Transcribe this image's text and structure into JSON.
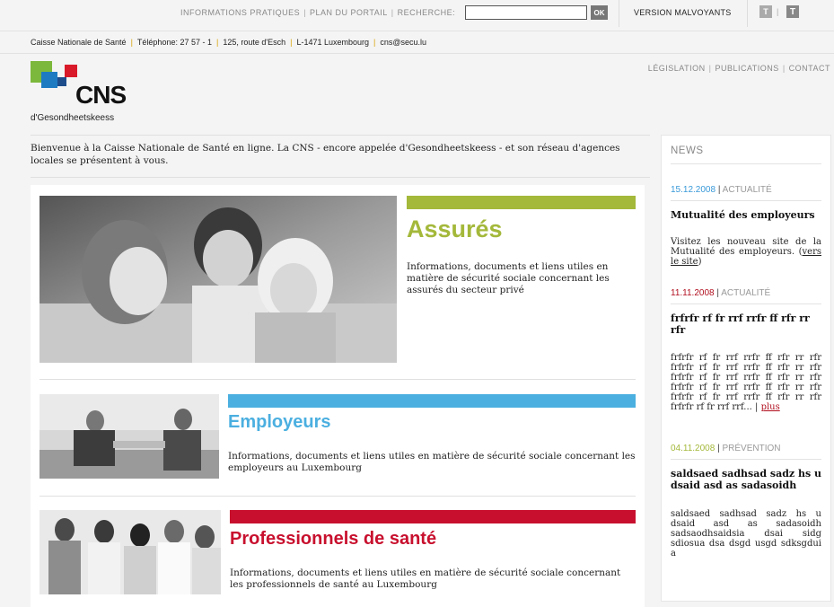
{
  "top_nav": {
    "info": "INFORMATIONS PRATIQUES",
    "plan": "PLAN DU PORTAIL",
    "recherche": "RECHERCHE:",
    "ok": "OK",
    "malvoyants": "VERSION MALVOYANTS",
    "t_small": "T",
    "t_large": "T"
  },
  "search": {
    "value": ""
  },
  "address": {
    "org": "Caisse Nationale de Santé",
    "phone": "Téléphone: 27 57 - 1",
    "street": "125, route d'Esch",
    "city": "L-1471 Luxembourg",
    "email": "cns@secu.lu"
  },
  "logo": {
    "text": "CNS",
    "sub": "d'Gesondheetskeess"
  },
  "right_links": {
    "legislation": "LÉGISLATION",
    "publications": "PUBLICATIONS",
    "contact": "CONTACT"
  },
  "intro": "Bienvenue à la Caisse Nationale de Santé en ligne. La CNS - encore appelée d'Gesondheetskeess - et son réseau d'agences locales se présentent à vous.",
  "sections": [
    {
      "title": "Assurés",
      "desc": "Informations, documents et liens utiles en matière de sécurité sociale concernant les assurés du secteur privé",
      "color": "#a4b83a"
    },
    {
      "title": "Employeurs",
      "desc": "Informations, documents et liens utiles en matière de sécurité sociale concernant les employeurs au Luxembourg",
      "color": "#4bafe0"
    },
    {
      "title": "Professionnels de santé",
      "desc": "Informations, documents et liens utiles en matière de sécurité sociale concernant les professionnels de santé au Luxembourg",
      "color": "#c8102e"
    }
  ],
  "news": {
    "title": "NEWS",
    "items": [
      {
        "date": "15.12.2008",
        "cat": "ACTUALITÉ",
        "date_color": "#3a9ad9",
        "head": "Mutualité des employeurs",
        "body": "Visitez les nouveau site de la Mutualité des employeurs.",
        "link": "vers le site"
      },
      {
        "date": "11.11.2008",
        "cat": "ACTUALITÉ",
        "date_color": "#b10f1f",
        "head": "frfrfr rf fr rrf rrfr ff rfr rr rfr",
        "body": "frfrfr rf fr rrf rrfr ff rfr rr rfr frfrfr rf fr rrf rrfr ff rfr rr rfr frfrfr rf fr rrf rrfr ff rfr rr rfr frfrfr rf fr rrf rrfr ff rfr rr rfr frfrfr rf fr rrf rrfr ff rfr rr rfr frfrfr rf fr rrf rrf...",
        "link": "plus"
      },
      {
        "date": "04.11.2008",
        "cat": "PRÉVENTION",
        "date_color": "#a4b83a",
        "head": "saldsaed sadhsad sadz hs u dsaid asd as sadasoidh",
        "body": "saldsaed sadhsad sadz hs u dsaid asd as sadasoidh sadsaodhsaidsia dsai sidg sdiosua dsa dsgd usgd sdksgdui a",
        "link": ""
      }
    ]
  }
}
